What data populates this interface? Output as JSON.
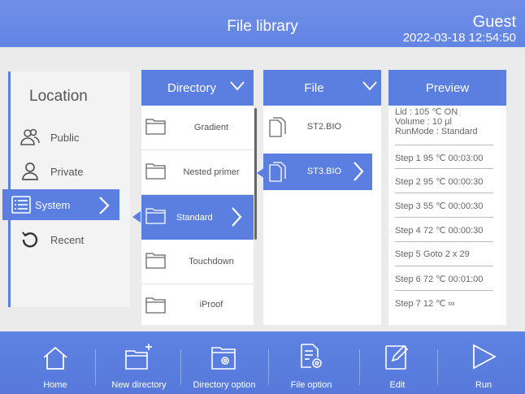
{
  "header": {
    "title": "File library",
    "user": "Guest",
    "datetime": "2022-03-18 12:54:50"
  },
  "location": {
    "title": "Location",
    "items": [
      {
        "label": "Public",
        "icon": "users-icon"
      },
      {
        "label": "Private",
        "icon": "user-icon"
      },
      {
        "label": "System",
        "icon": "list-icon",
        "active": true
      },
      {
        "label": "Recent",
        "icon": "history-icon"
      }
    ]
  },
  "directory": {
    "header": "Directory",
    "items": [
      "Gradient",
      "Nested primer",
      "Standard",
      "Touchdown",
      "iProof"
    ],
    "selected": "Standard"
  },
  "file": {
    "header": "File",
    "items": [
      "ST2.BIO",
      "ST3.BIO"
    ],
    "selected": "ST3.BIO"
  },
  "preview": {
    "header": "Preview",
    "lid": "Lid : 105 ℃  ON",
    "volume": "Volume : 10 μl",
    "runmode": "RunMode : Standard",
    "steps": [
      "Step 1  95 ℃ 00:03:00",
      "Step 2  95 ℃ 00:00:30",
      "Step 3  55 ℃ 00:00:30",
      "Step 4  72 ℃ 00:00:30",
      "Step 5    Goto 2    x 29",
      "Step 6  72 ℃ 00:01:00",
      "Step 7  12 ℃ ∞"
    ]
  },
  "toolbar": {
    "home": "Home",
    "new_directory": "New directory",
    "directory_option": "Directory option",
    "file_option": "File option",
    "edit": "Edit",
    "run": "Run"
  },
  "colors": {
    "accent": "#5b7fe0",
    "header": "#6284e3",
    "panel_bg": "#ebebeb"
  }
}
